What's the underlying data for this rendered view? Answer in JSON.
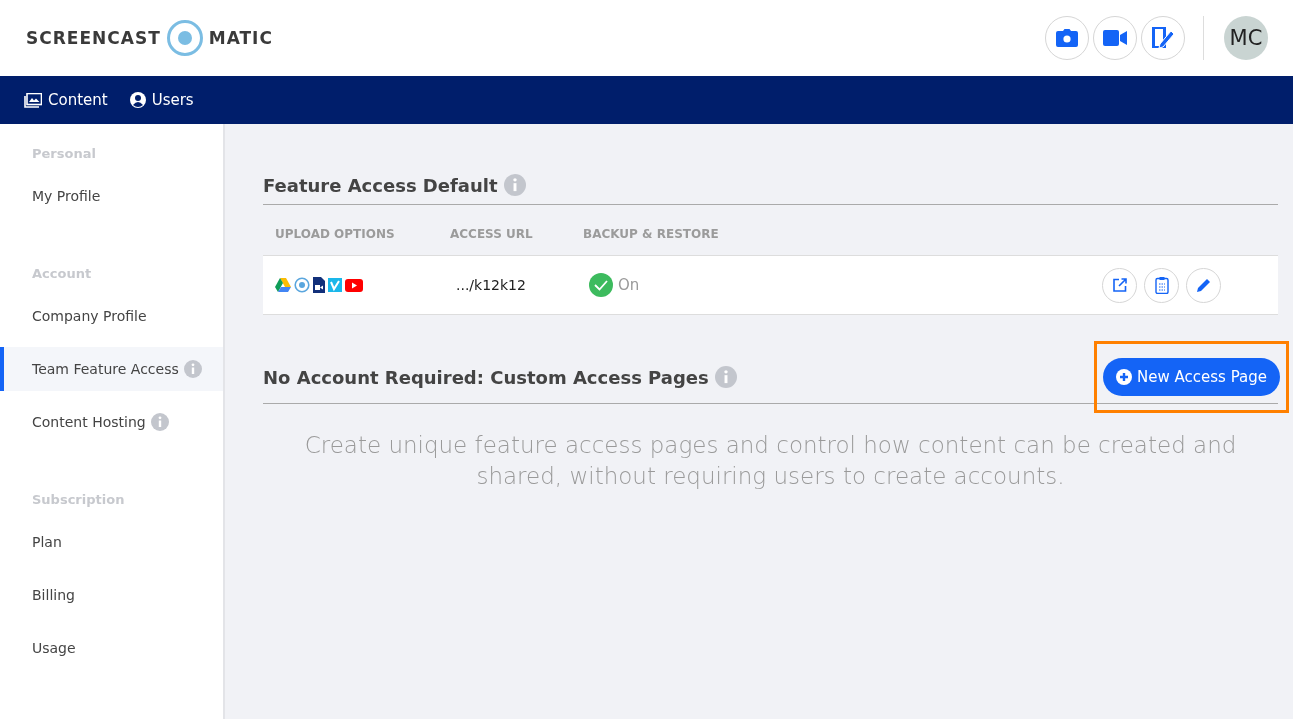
{
  "header": {
    "logo": {
      "left": "SCREENCAST",
      "right": "MATIC"
    },
    "tools": [
      {
        "kind": "camera"
      },
      {
        "kind": "video"
      },
      {
        "kind": "edit"
      }
    ],
    "avatar": "MC"
  },
  "nav": [
    {
      "kind": "content",
      "label": "Content"
    },
    {
      "kind": "users",
      "label": "Users"
    }
  ],
  "sidebar": [
    {
      "heading": "Personal",
      "items": [
        {
          "label": "My Profile",
          "selected": false,
          "info": false
        }
      ]
    },
    {
      "heading": "Account",
      "items": [
        {
          "label": "Company Profile",
          "selected": false,
          "info": false
        },
        {
          "label": "Team Feature Access",
          "selected": true,
          "info": true
        },
        {
          "label": "Content Hosting",
          "selected": false,
          "info": true
        }
      ]
    },
    {
      "heading": "Subscription",
      "items": [
        {
          "label": "Plan",
          "selected": false,
          "info": false
        },
        {
          "label": "Billing",
          "selected": false,
          "info": false
        },
        {
          "label": "Usage",
          "selected": false,
          "info": false
        }
      ]
    }
  ],
  "feature_access": {
    "title": "Feature Access Default",
    "columns": [
      "UPLOAD OPTIONS",
      "ACCESS URL",
      "BACKUP & RESTORE"
    ],
    "row": {
      "upload_options": [
        {
          "kind": "drive"
        },
        {
          "kind": "screencast"
        },
        {
          "kind": "file"
        },
        {
          "kind": "vimeo"
        },
        {
          "kind": "youtube"
        }
      ],
      "access_url": ".../k12k12",
      "backup": {
        "checked": true,
        "label": "On"
      },
      "actions": [
        {
          "kind": "open"
        },
        {
          "kind": "clipboard"
        },
        {
          "kind": "edit"
        }
      ]
    }
  },
  "custom_pages": {
    "title": "No Account Required: Custom Access Pages",
    "button": {
      "label": "New Access Page",
      "highlighted": true
    },
    "empty_text": "Create unique feature access pages and control how content can be created and shared, without requiring users to create accounts."
  }
}
